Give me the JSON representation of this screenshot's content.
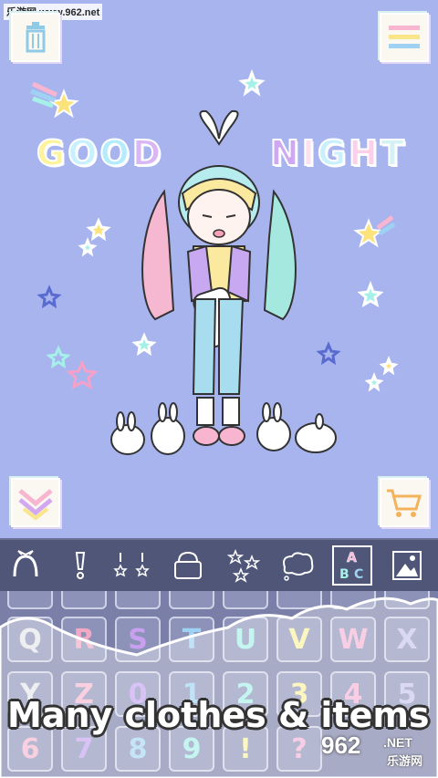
{
  "watermark": "乐游网 www.962.net",
  "scene": {
    "headline_left": [
      "G",
      "O",
      "O",
      "D"
    ],
    "headline_left_colors": [
      "#fdf39a",
      "#c9f0ff",
      "#c9f0ff",
      "#d9b7f5"
    ],
    "headline_right": [
      "N",
      "I",
      "G",
      "H",
      "T"
    ],
    "headline_right_colors": [
      "#cfa8f2",
      "#fde0f0",
      "#c9f0ff",
      "#fbd0e8",
      "#d4f2f3"
    ],
    "buttons": {
      "trash": "trash-icon",
      "menu": "menu-icon",
      "collapse": "chevron-down-icon",
      "shop": "cart-icon"
    }
  },
  "toolbar": {
    "tools": [
      {
        "name": "headband",
        "icon": "headband-icon"
      },
      {
        "name": "exclamation",
        "icon": "exclamation-icon"
      },
      {
        "name": "earrings",
        "icon": "earrings-icon"
      },
      {
        "name": "bag",
        "icon": "bag-icon"
      },
      {
        "name": "stars",
        "icon": "stars-icon"
      },
      {
        "name": "speech",
        "icon": "speech-bubble-icon"
      },
      {
        "name": "letters",
        "icon": "letters-icon",
        "label": "ABC"
      },
      {
        "name": "background",
        "icon": "picture-icon"
      }
    ],
    "selected": "letters"
  },
  "keyboard": {
    "row1": [
      "Q",
      "R",
      "S",
      "T",
      "U",
      "V",
      "W",
      "X"
    ],
    "row1_colors": [
      "#e5e6ea",
      "#f2a9c4",
      "#c99ff0",
      "#9fd2f2",
      "#a5f0e8",
      "#fbf1a0",
      "#f4b4d8",
      "#c8c4ee"
    ],
    "row2": [
      "Y",
      "Z",
      "0",
      "1",
      "2",
      "3",
      "4",
      "5"
    ],
    "row2_colors": [
      "#e5e6ea",
      "#f5b7cf",
      "#c5a3f2",
      "#9fd2f2",
      "#a5f0e8",
      "#fbf1a0",
      "#f4b4d8",
      "#c8c4ee"
    ],
    "row3": [
      "6",
      "7",
      "8",
      "9",
      "!",
      "?"
    ],
    "row3_colors": [
      "#f5b7cf",
      "#c5a3f2",
      "#a5d8f2",
      "#a5f0e8",
      "#fbf1a0",
      "#f4b4d8"
    ]
  },
  "caption": "Many clothes & items",
  "logo": {
    "num": "962",
    "net": ".NET",
    "cn": "乐游网"
  }
}
